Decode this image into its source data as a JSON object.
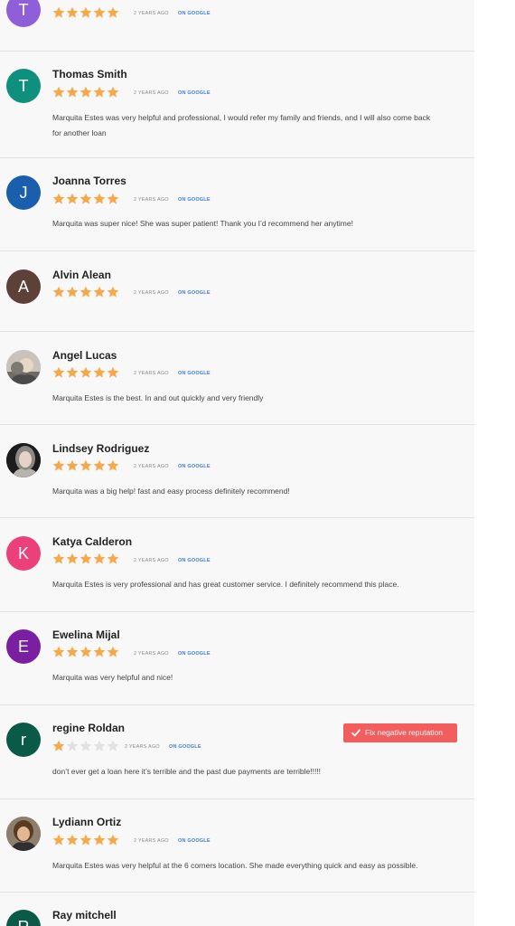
{
  "colors": {
    "star_filled": "#f6a94b",
    "star_empty": "#e2e2e2",
    "source_link": "#3b7de0",
    "fix_button": "#f45d5d"
  },
  "reviews": [
    {
      "avatar_letter": "T",
      "avatar_color": "#8e5fd8",
      "rating": 5,
      "time": "2 YEARS AGO",
      "source": "ON GOOGLE"
    },
    {
      "name": "Thomas Smith",
      "avatar_letter": "T",
      "avatar_color": "#0f8f7d",
      "rating": 5,
      "time": "2 YEARS AGO",
      "source": "ON GOOGLE",
      "text": "Marquita Estes was very helpful and professional, I would refer my family and friends, and I will also come back for another loan"
    },
    {
      "name": "Joanna Torres",
      "avatar_letter": "J",
      "avatar_color": "#1a5fae",
      "rating": 5,
      "time": "2 YEARS AGO",
      "source": "ON GOOGLE",
      "text": "Marquita was super nice! She was super patient! Thank you I’d recommend her anytime!"
    },
    {
      "name": "Alvin Alean",
      "avatar_letter": "A",
      "avatar_color": "#5d4037",
      "rating": 5,
      "time": "2 YEARS AGO",
      "source": "ON GOOGLE"
    },
    {
      "name": "Angel Lucas",
      "avatar_icon": "person-photo-icon",
      "rating": 5,
      "time": "2 YEARS AGO",
      "source": "ON GOOGLE",
      "text": "Marquita Estes is the best. In and out quickly and very friendly"
    },
    {
      "name": "Lindsey Rodriguez",
      "avatar_icon": "person-photo-icon",
      "rating": 5,
      "time": "2 YEARS AGO",
      "source": "ON GOOGLE",
      "text": "Marquita was a big help! fast and easy process definitely recommend!"
    },
    {
      "name": "Katya Calderon",
      "avatar_letter": "K",
      "avatar_color": "#ec407a",
      "rating": 5,
      "time": "2 YEARS AGO",
      "source": "ON GOOGLE",
      "text": "Marquita Estes is very professional and has great customer service. I definitely recommend this place."
    },
    {
      "name": "Ewelina Mijal",
      "avatar_letter": "E",
      "avatar_color": "#7b1fa2",
      "rating": 5,
      "time": "2 YEARS AGO",
      "source": "ON GOOGLE",
      "text": "Marquita was very helpful and nice!"
    },
    {
      "name": "regine Roldan",
      "avatar_letter": "r",
      "avatar_color": "#0b5a47",
      "rating": 1,
      "time": "2 YEARS AGO",
      "source": "ON GOOGLE",
      "text": "don’t ever get a loan here it’s terrible and the past due payments are terrible!!!!!",
      "action_label": "Fix negative reputation"
    },
    {
      "name": "Lydiann Ortiz",
      "avatar_icon": "person-photo-icon",
      "rating": 5,
      "time": "2 YEARS AGO",
      "source": "ON GOOGLE",
      "text": "Marquita Estes was very helpful at the 6 corners location. She made everything quick and easy as possible."
    },
    {
      "name": "Ray mitchell",
      "avatar_letter": "R",
      "avatar_color": "#0b5a47"
    }
  ]
}
